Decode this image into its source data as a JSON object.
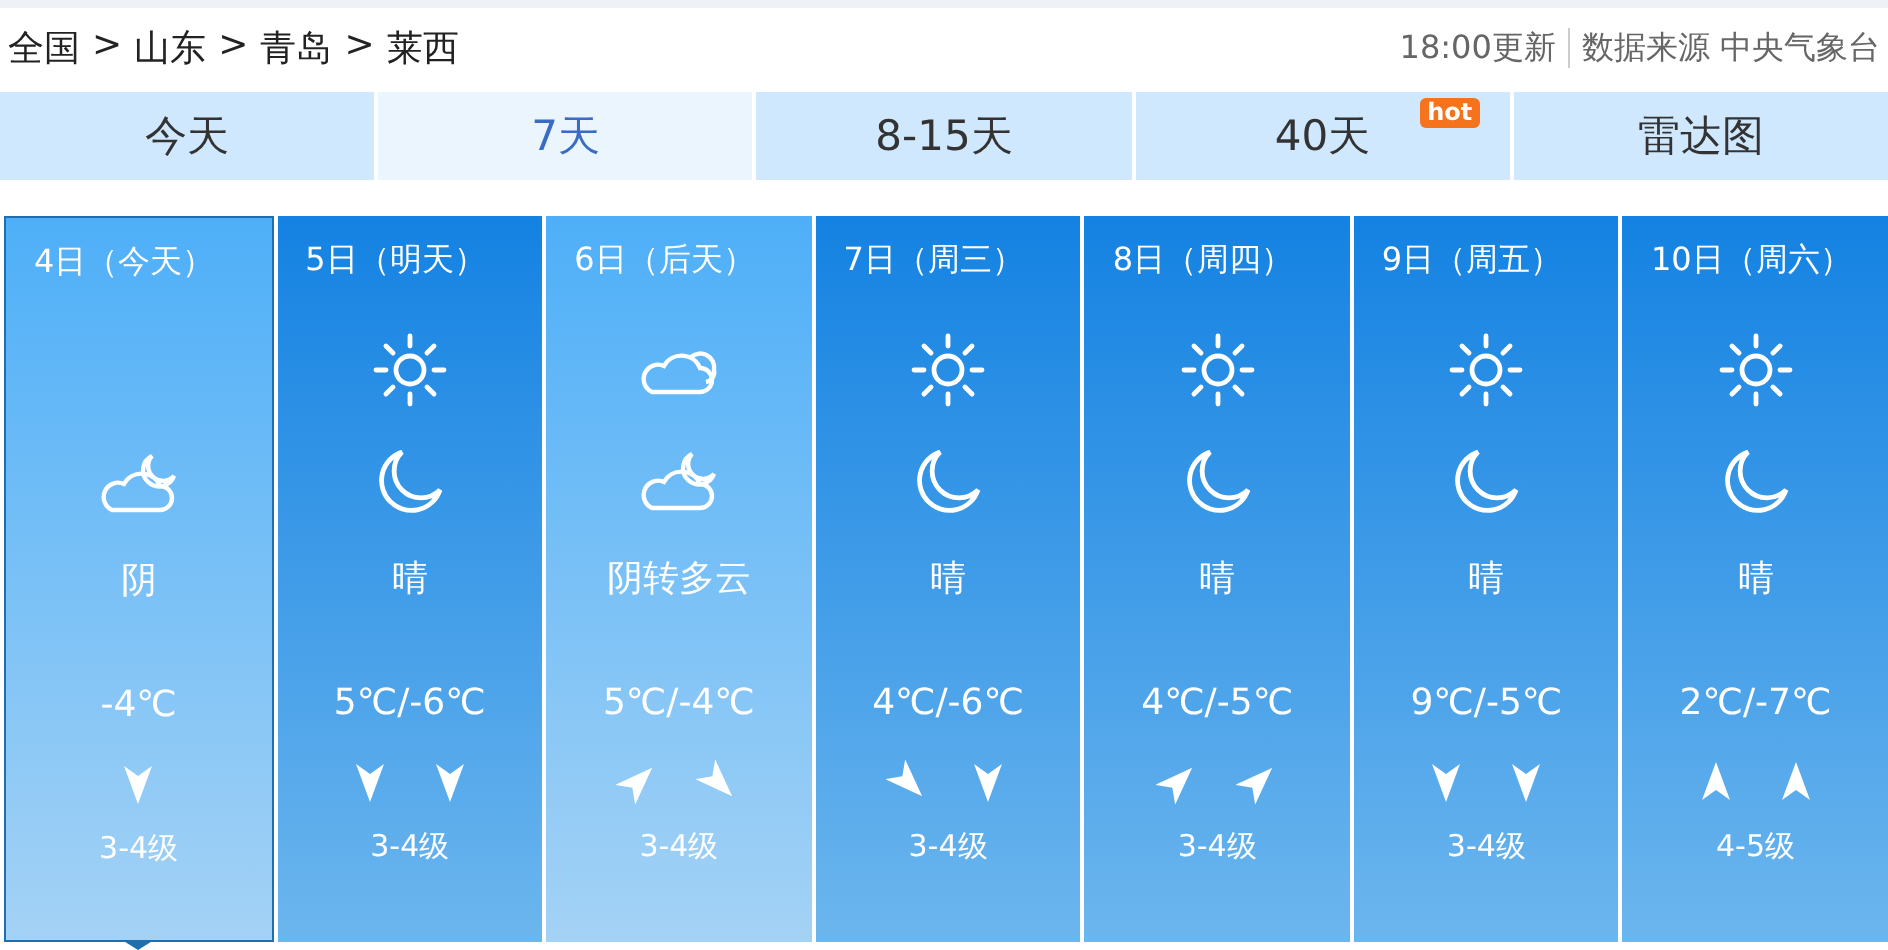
{
  "breadcrumb": [
    "全国",
    "山东",
    "青岛",
    "莱西"
  ],
  "breadcrumb_separator": ">",
  "update_time": "18:00更新",
  "source": "数据来源 中央气象台",
  "tabs": [
    {
      "label": "今天",
      "selected": false
    },
    {
      "label": "7天",
      "selected": true
    },
    {
      "label": "8-15天",
      "selected": false
    },
    {
      "label": "40天",
      "selected": false,
      "badge": "hot"
    },
    {
      "label": "雷达图",
      "selected": false
    }
  ],
  "days": [
    {
      "date": "4日（今天）",
      "icons": [
        {
          "kind": "blank"
        },
        {
          "kind": "cloudmoon"
        }
      ],
      "weather": "阴",
      "temp": "-4℃",
      "winds": [
        {
          "kind": "down"
        }
      ],
      "wind_level": "3-4级",
      "selected": true,
      "light": true
    },
    {
      "date": "5日（明天）",
      "icons": [
        {
          "kind": "sun"
        },
        {
          "kind": "moon"
        }
      ],
      "weather": "晴",
      "temp": "5℃/-6℃",
      "winds": [
        {
          "kind": "down"
        },
        {
          "kind": "down"
        }
      ],
      "wind_level": "3-4级",
      "selected": false,
      "light": false
    },
    {
      "date": "6日（后天）",
      "icons": [
        {
          "kind": "cloud"
        },
        {
          "kind": "cloudmoon"
        }
      ],
      "weather": "阴转多云",
      "temp": "5℃/-4℃",
      "winds": [
        {
          "kind": "upright"
        },
        {
          "kind": "downright"
        }
      ],
      "wind_level": "3-4级",
      "selected": false,
      "light": true
    },
    {
      "date": "7日（周三）",
      "icons": [
        {
          "kind": "sun"
        },
        {
          "kind": "moon"
        }
      ],
      "weather": "晴",
      "temp": "4℃/-6℃",
      "winds": [
        {
          "kind": "downright"
        },
        {
          "kind": "down"
        }
      ],
      "wind_level": "3-4级",
      "selected": false,
      "light": false
    },
    {
      "date": "8日（周四）",
      "icons": [
        {
          "kind": "sun"
        },
        {
          "kind": "moon"
        }
      ],
      "weather": "晴",
      "temp": "4℃/-5℃",
      "winds": [
        {
          "kind": "upright"
        },
        {
          "kind": "upright"
        }
      ],
      "wind_level": "3-4级",
      "selected": false,
      "light": false
    },
    {
      "date": "9日（周五）",
      "icons": [
        {
          "kind": "sun"
        },
        {
          "kind": "moon"
        }
      ],
      "weather": "晴",
      "temp": "9℃/-5℃",
      "winds": [
        {
          "kind": "down"
        },
        {
          "kind": "down"
        }
      ],
      "wind_level": "3-4级",
      "selected": false,
      "light": false
    },
    {
      "date": "10日（周六）",
      "icons": [
        {
          "kind": "sun"
        },
        {
          "kind": "moon"
        }
      ],
      "weather": "晴",
      "temp": "2℃/-7℃",
      "winds": [
        {
          "kind": "up"
        },
        {
          "kind": "up"
        }
      ],
      "wind_level": "4-5级",
      "selected": false,
      "light": false
    }
  ]
}
